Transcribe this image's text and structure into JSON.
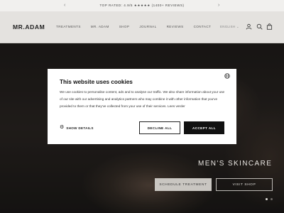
{
  "announcement": {
    "text": "TOP RATED: 4.9/5 ★★★★★ (1400+ REVIEWS)"
  },
  "header": {
    "logo": "MR.ADAM",
    "nav": [
      "TREATMENTS",
      "MR. ADAM",
      "SHOP",
      "JOURNAL",
      "REVIEWS",
      "CONTACT"
    ],
    "language": "ENGLISH"
  },
  "hero": {
    "title": "MEN'S SKINCARE",
    "schedule_label": "SCHEDULE TREATMENT",
    "visit_label": "VISIT SHOP"
  },
  "cookie": {
    "title": "This website uses cookies",
    "body": "We use cookies to personalise content, ads and to analyse our traffic. We also share information about your use of our site with our advertising and analytics partners who may combine it with other information that you've provided to them or that they've collected from your use of their services. Lees verder",
    "show_details": "SHOW DETAILS",
    "decline": "DECLINE ALL",
    "accept": "ACCEPT ALL"
  },
  "colors": {
    "accept_bg": "#111111",
    "header_bg": "#e4e2df"
  },
  "icons": [
    "chevron-left-icon",
    "chevron-right-icon",
    "chevron-down-icon",
    "account-icon",
    "search-icon",
    "bag-icon",
    "globe-icon",
    "gear-icon"
  ]
}
